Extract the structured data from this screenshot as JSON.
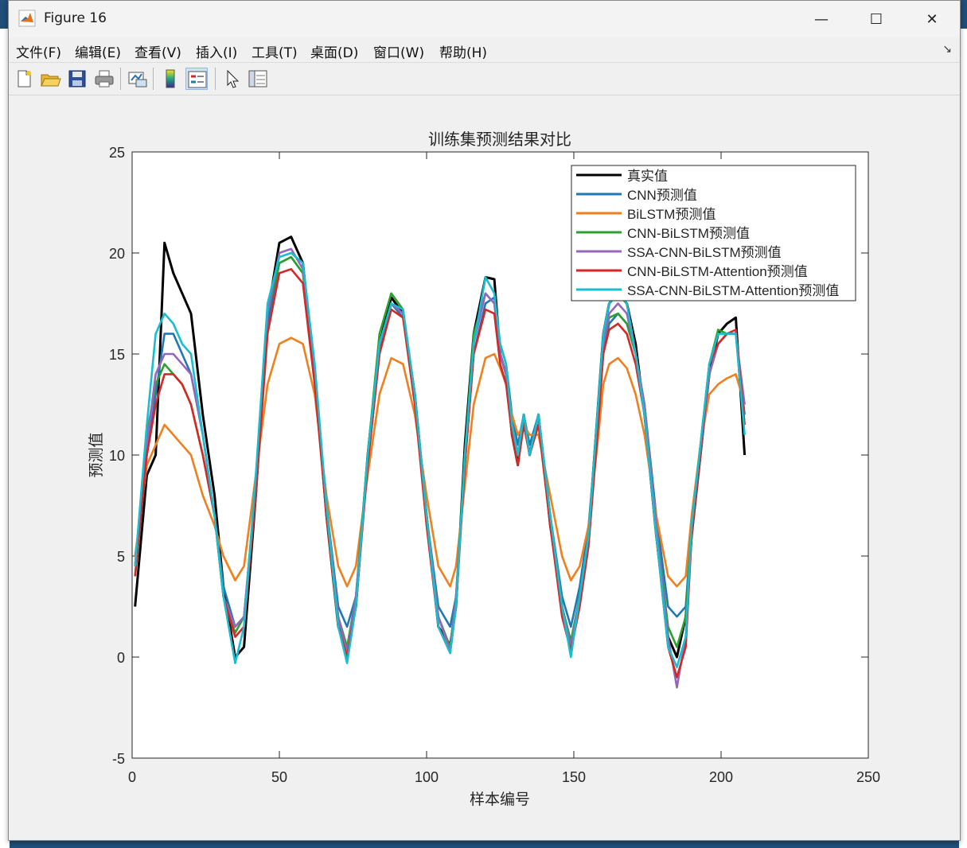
{
  "window": {
    "title": "Figure 16",
    "minimize_glyph": "—",
    "maximize_glyph": "☐",
    "close_glyph": "✕"
  },
  "menu": [
    {
      "label": "文件(F)"
    },
    {
      "label": "编辑(E)"
    },
    {
      "label": "查看(V)"
    },
    {
      "label": "插入(I)"
    },
    {
      "label": "工具(T)"
    },
    {
      "label": "桌面(D)"
    },
    {
      "label": "窗口(W)"
    },
    {
      "label": "帮助(H)"
    }
  ],
  "menu_arrow": "↘",
  "toolbar": [
    {
      "icon": "new-figure-icon"
    },
    {
      "icon": "open-file-icon"
    },
    {
      "icon": "save-icon"
    },
    {
      "icon": "print-icon"
    },
    {
      "icon": "link-plot-icon"
    },
    {
      "icon": "colorbar-icon"
    },
    {
      "icon": "legend-icon"
    },
    {
      "icon": "pointer-icon"
    },
    {
      "icon": "property-inspector-icon"
    }
  ],
  "colors": {
    "true": "#000000",
    "cnn": "#1f77b4",
    "bilstm": "#f07f1e",
    "cnn_bilstm": "#2ca02c",
    "ssa_cnn_bilstm": "#9467bd",
    "cnn_bilstm_att": "#d62728",
    "ssa_cnn_bilstm_att": "#17becf"
  },
  "chart_data": {
    "type": "line",
    "title": "训练集预测结果对比",
    "xlabel": "样本编号",
    "ylabel": "预测值",
    "xlim": [
      0,
      250
    ],
    "ylim": [
      -5,
      25
    ],
    "xticks": [
      0,
      50,
      100,
      150,
      200,
      250
    ],
    "yticks": [
      -5,
      0,
      5,
      10,
      15,
      20,
      25
    ],
    "grid": false,
    "legend_position": "top-right",
    "x": [
      1,
      5,
      8,
      11,
      14,
      17,
      20,
      24,
      28,
      31,
      35,
      38,
      42,
      46,
      50,
      54,
      58,
      62,
      66,
      70,
      73,
      76,
      80,
      84,
      88,
      92,
      96,
      100,
      104,
      108,
      110,
      113,
      116,
      120,
      123,
      125,
      127,
      129,
      131,
      133,
      135,
      138,
      142,
      146,
      149,
      152,
      155,
      158,
      160,
      162,
      165,
      168,
      171,
      174,
      178,
      182,
      185,
      188,
      190,
      193,
      196,
      199,
      202,
      205,
      208
    ],
    "series": [
      {
        "name": "真实值",
        "color_key": "true",
        "values": [
          2.5,
          9,
          10,
          20.5,
          19,
          18,
          17,
          12,
          8,
          3.5,
          0,
          0.5,
          8,
          17,
          20.5,
          20.8,
          19.5,
          14,
          7,
          1.5,
          0.3,
          2.5,
          10,
          15.5,
          17.8,
          17,
          13,
          7,
          1.5,
          0.6,
          2.5,
          10.5,
          16,
          18.8,
          18.7,
          15,
          14,
          11,
          9.5,
          12,
          10,
          12,
          6.5,
          2.5,
          0.5,
          3,
          6,
          12,
          16,
          17.5,
          18,
          17.5,
          15.5,
          12,
          6,
          1,
          0,
          2,
          6,
          10,
          14,
          16,
          16.5,
          16.8,
          10
        ]
      },
      {
        "name": "CNN预测值",
        "color_key": "cnn",
        "values": [
          4,
          10,
          13,
          16,
          16,
          15,
          14,
          11,
          7,
          3.5,
          1.5,
          2,
          8,
          16.5,
          19.5,
          19.8,
          19,
          14,
          7.5,
          2.5,
          1.5,
          3,
          9.5,
          15,
          17.5,
          16.8,
          13,
          7,
          2.5,
          1.5,
          3,
          9.5,
          15,
          17.5,
          17.8,
          15.5,
          14.5,
          12,
          10.5,
          12,
          10.5,
          12,
          7,
          3,
          1.5,
          3.5,
          6.5,
          11.5,
          15,
          16.5,
          17,
          16.5,
          15,
          12.5,
          7,
          2.5,
          2,
          2.5,
          6.5,
          10,
          14,
          15.5,
          16,
          16,
          12
        ]
      },
      {
        "name": "BiLSTM预测值",
        "color_key": "bilstm",
        "values": [
          5,
          9.5,
          10.5,
          11.5,
          11,
          10.5,
          10,
          8,
          6.5,
          5,
          3.8,
          4.5,
          9,
          13.5,
          15.5,
          15.8,
          15.5,
          13,
          8,
          4.5,
          3.5,
          4.5,
          9,
          13,
          14.8,
          14.5,
          12,
          8,
          4.5,
          3.5,
          4.5,
          8.5,
          12.5,
          14.8,
          15,
          14.3,
          13.5,
          12,
          11,
          11.5,
          11,
          11,
          8,
          5,
          3.8,
          4.5,
          6.5,
          10.5,
          13.5,
          14.5,
          14.8,
          14.3,
          13,
          11,
          7,
          4,
          3.5,
          4,
          7,
          10.5,
          13,
          13.5,
          13.8,
          14,
          12.5
        ]
      },
      {
        "name": "CNN-BiLSTM预测值",
        "color_key": "cnn_bilstm",
        "values": [
          4.5,
          11,
          13.5,
          14.5,
          14,
          13.5,
          12.5,
          10,
          7,
          3,
          1.2,
          2,
          8.5,
          17,
          19.5,
          19.8,
          19,
          14,
          7.5,
          2,
          0.5,
          3,
          10,
          16,
          18,
          17.2,
          13,
          7,
          2,
          0.5,
          3,
          10,
          16,
          18,
          17.5,
          15,
          14,
          11.5,
          10,
          12,
          10,
          12,
          7,
          2.5,
          0.8,
          3,
          6,
          12,
          15.5,
          16.8,
          17,
          16.5,
          15,
          12.5,
          6.5,
          1.5,
          0.5,
          2,
          6.5,
          10.5,
          14.5,
          16.2,
          16,
          16,
          11.5
        ]
      },
      {
        "name": "SSA-CNN-BiLSTM预测值",
        "color_key": "ssa_cnn_bilstm",
        "values": [
          4.5,
          10.5,
          14,
          15,
          15,
          14.5,
          14,
          11,
          7,
          3,
          1.5,
          2,
          8.5,
          17,
          20,
          20.2,
          19.2,
          14,
          7.5,
          2,
          0.2,
          3,
          9.5,
          15.5,
          17.5,
          17,
          13,
          7,
          2,
          0.3,
          3,
          9.5,
          15.5,
          18,
          17.5,
          15,
          14,
          11.5,
          10,
          12,
          10,
          12,
          7,
          2.5,
          0.5,
          3,
          6,
          11.5,
          15.5,
          17,
          17.5,
          17,
          15,
          12.5,
          6.5,
          1,
          -1.5,
          1,
          6.5,
          10,
          14,
          15.5,
          16,
          16,
          12.5
        ]
      },
      {
        "name": "CNN-BiLSTM-Attention预测值",
        "color_key": "cnn_bilstm_att",
        "values": [
          4,
          10,
          12.5,
          14,
          14,
          13.5,
          12.5,
          10,
          7,
          3,
          1,
          1.5,
          8,
          16,
          19,
          19.2,
          18.5,
          13.5,
          7,
          1.5,
          0,
          2.5,
          9.5,
          15,
          17.2,
          16.8,
          12.5,
          6.5,
          1.5,
          0.2,
          2.5,
          9.5,
          15,
          17.2,
          17,
          14.5,
          13.5,
          11,
          9.5,
          11.5,
          10,
          11.5,
          6.5,
          2,
          0.3,
          2.5,
          5.5,
          11,
          15,
          16.2,
          16.5,
          16,
          14.5,
          12,
          6,
          0.5,
          -1,
          0.5,
          6,
          10,
          14.5,
          15.5,
          16,
          16.2,
          11.5
        ]
      },
      {
        "name": "SSA-CNN-BiLSTM-Attention预测值",
        "color_key": "ssa_cnn_bilstm_att",
        "values": [
          4.5,
          11.5,
          16,
          17,
          16.5,
          15.5,
          15,
          11,
          7,
          3,
          -0.3,
          1.5,
          9,
          17.5,
          19.8,
          20,
          19.5,
          14.5,
          7.5,
          1.5,
          -0.3,
          2.5,
          10,
          15.5,
          17.5,
          17.2,
          13,
          7,
          1.5,
          0.2,
          2.5,
          10,
          15.5,
          18.8,
          18,
          15.5,
          14.5,
          11.5,
          10,
          12,
          10,
          12,
          7,
          2.5,
          0,
          3,
          6,
          12,
          16,
          17.5,
          18,
          17.5,
          15,
          12,
          6,
          0.5,
          -0.5,
          1,
          6.5,
          10.5,
          14.5,
          16,
          16,
          16,
          11
        ]
      }
    ]
  }
}
